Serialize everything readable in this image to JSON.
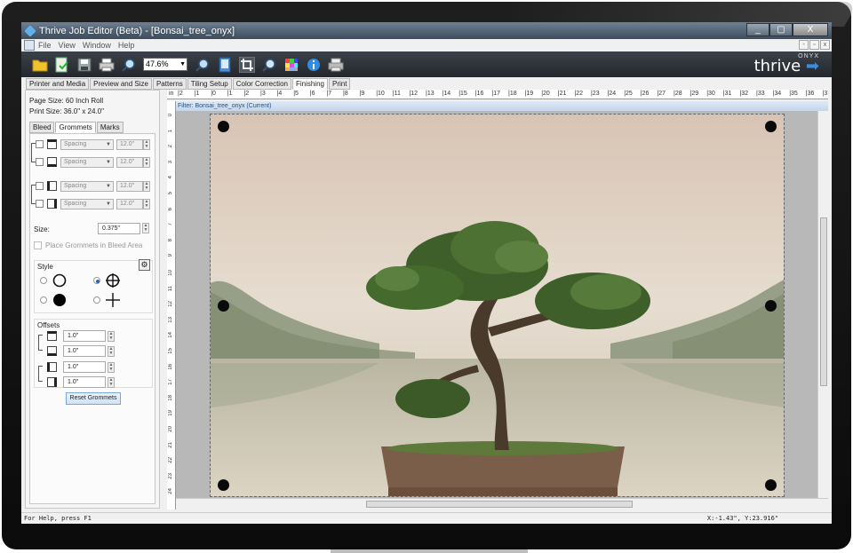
{
  "window": {
    "title": "Thrive Job Editor (Beta) - [Bonsai_tree_onyx]",
    "controls": [
      "_",
      "▢",
      "X"
    ]
  },
  "menu": {
    "items": [
      "File",
      "View",
      "Window",
      "Help"
    ],
    "mdi_controls": [
      "-",
      "▫",
      "x"
    ]
  },
  "toolbar": {
    "zoom_value": "47.6%",
    "icons": [
      "open-folder-icon",
      "export-icon",
      "save-icon",
      "print-icon",
      "zoom-out-icon",
      "zoom-in-icon",
      "page-icon",
      "crop-icon",
      "magnify-icon",
      "color-grid-icon",
      "info-icon",
      "printer-icon"
    ],
    "brand_small": "ONYX",
    "brand_large": "thrive"
  },
  "tabs": [
    {
      "label": "Printer and Media",
      "active": false
    },
    {
      "label": "Preview and Size",
      "active": false
    },
    {
      "label": "Patterns",
      "active": false
    },
    {
      "label": "Tiling Setup",
      "active": false
    },
    {
      "label": "Color Correction",
      "active": false
    },
    {
      "label": "Finishing",
      "active": true
    },
    {
      "label": "Print",
      "active": false
    }
  ],
  "panel": {
    "page_size": "Page Size: 60 Inch Roll",
    "print_size": "Print Size: 36.0\" x 24.0\"",
    "subtabs": [
      {
        "label": "Bleed",
        "active": false
      },
      {
        "label": "Grommets",
        "active": true
      },
      {
        "label": "Marks",
        "active": false
      }
    ],
    "grommet_rows": [
      {
        "mode": "Spacing",
        "value": "12.0\""
      },
      {
        "mode": "Spacing",
        "value": "12.0\""
      },
      {
        "mode": "Spacing",
        "value": "12.0\""
      },
      {
        "mode": "Spacing",
        "value": "12.0\""
      }
    ],
    "size_label": "Size:",
    "size_value": "0.375\"",
    "bleed_option": "Place Grommets in Bleed Area",
    "style_label": "Style",
    "selected_style": "crosshair-circle",
    "offsets_label": "Offsets",
    "offsets": [
      "1.0\"",
      "1.0\"",
      "1.0\"",
      "1.0\""
    ],
    "reset_label": "Reset Grommets"
  },
  "ruler": {
    "unit": "in",
    "top_ticks": [
      "2",
      "1",
      "0",
      "1",
      "2",
      "3",
      "4",
      "5",
      "6",
      "7",
      "8",
      "9",
      "10",
      "11",
      "12",
      "13",
      "14",
      "15",
      "16",
      "17",
      "18",
      "19",
      "20",
      "21",
      "22",
      "23",
      "24",
      "25",
      "26",
      "27",
      "28",
      "29",
      "30",
      "31",
      "32",
      "33",
      "34",
      "35",
      "36",
      "37"
    ],
    "left_ticks": [
      "0",
      "1",
      "2",
      "3",
      "4",
      "5",
      "6",
      "7",
      "8",
      "9",
      "10",
      "11",
      "12",
      "13",
      "14",
      "15",
      "16",
      "17",
      "18",
      "19",
      "20",
      "21",
      "22",
      "23",
      "24"
    ]
  },
  "filter_label": "Filter: Bonsai_tree_onyx (Current)",
  "status": {
    "help": "For Help, press F1",
    "coords": "X:-1.43\", Y:23.916\""
  },
  "colors": {
    "titlebar": "#3d4c5c",
    "toolbar": "#2a2f34",
    "accent": "#2b66b8",
    "filter_bar": "#c4d6ea"
  }
}
